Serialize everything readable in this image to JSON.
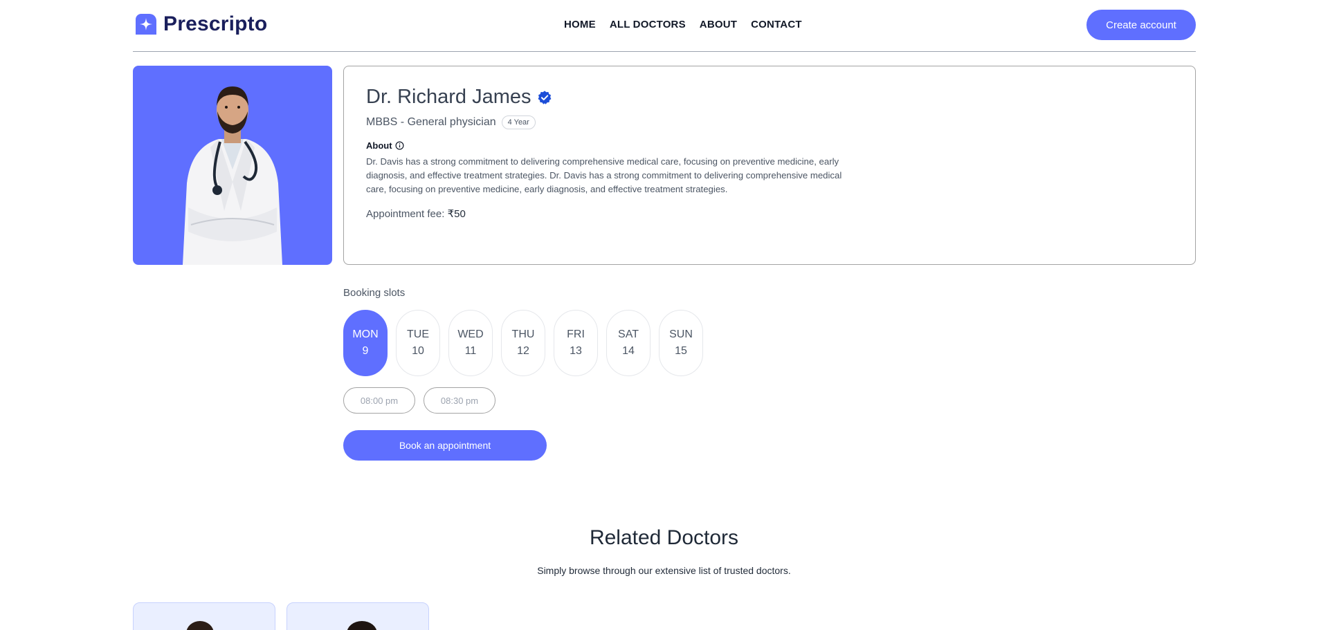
{
  "brand": {
    "name": "Prescripto",
    "logo_icon": "sparkle-shield-logo",
    "color": "#1a1f5c"
  },
  "nav": {
    "links": [
      "HOME",
      "ALL DOCTORS",
      "ABOUT",
      "CONTACT"
    ],
    "cta": "Create account"
  },
  "theme": {
    "accent": "#5f6fff",
    "verified": "#1d4ed8"
  },
  "doctor": {
    "name": "Dr. Richard James",
    "verified_icon": "verified-check-icon",
    "degree": "MBBS - General physician",
    "experience": "4 Year",
    "about_title": "About",
    "about_text": "Dr. Davis has a strong commitment to delivering comprehensive medical care, focusing on preventive medicine, early diagnosis, and effective treatment strategies. Dr. Davis has a strong commitment to delivering comprehensive medical care, focusing on preventive medicine, early diagnosis, and effective treatment strategies.",
    "fee_label": "Appointment fee:",
    "fee_value": "₹50"
  },
  "booking": {
    "title": "Booking slots",
    "days": [
      {
        "day": "MON",
        "date": "9"
      },
      {
        "day": "TUE",
        "date": "10"
      },
      {
        "day": "WED",
        "date": "11"
      },
      {
        "day": "THU",
        "date": "12"
      },
      {
        "day": "FRI",
        "date": "13"
      },
      {
        "day": "SAT",
        "date": "14"
      },
      {
        "day": "SUN",
        "date": "15"
      }
    ],
    "selected_day": "MON",
    "times": [
      "08:00 pm",
      "08:30 pm"
    ],
    "book_button": "Book an appointment"
  },
  "related": {
    "title": "Related Doctors",
    "subtitle": "Simply browse through our extensive list of trusted doctors."
  }
}
